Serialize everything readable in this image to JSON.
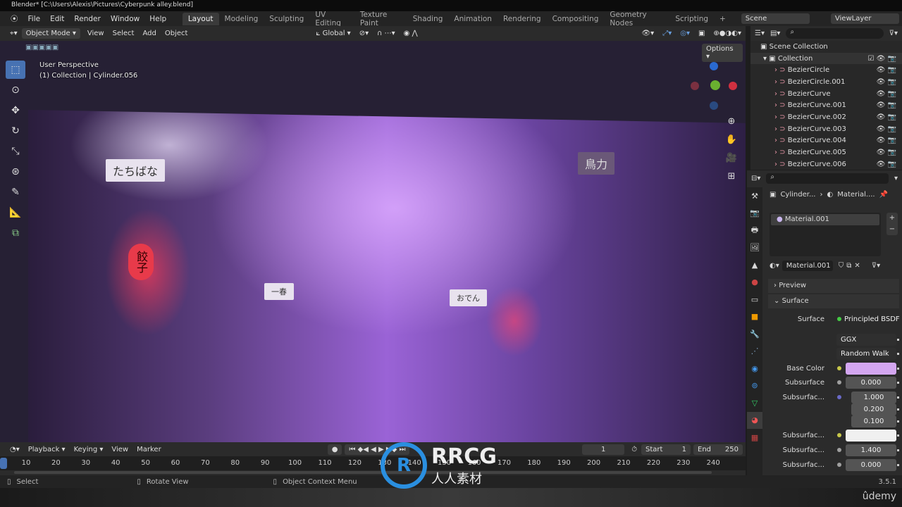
{
  "window_title": "Blender* [C:\\Users\\Alexis\\Pictures\\Cyberpunk alley.blend]",
  "menu": [
    "File",
    "Edit",
    "Render",
    "Window",
    "Help"
  ],
  "workspaces": [
    "Layout",
    "Modeling",
    "Sculpting",
    "UV Editing",
    "Texture Paint",
    "Shading",
    "Animation",
    "Rendering",
    "Compositing",
    "Geometry Nodes",
    "Scripting"
  ],
  "active_workspace": "Layout",
  "scene": "Scene",
  "view_layer": "ViewLayer",
  "viewport_header": {
    "mode": "Object Mode",
    "menus": [
      "View",
      "Select",
      "Add",
      "Object"
    ],
    "transform_orientation": "Global",
    "options": "Options"
  },
  "viewport_overlay": {
    "line1": "User Perspective",
    "line2": "(1) Collection | Cylinder.056"
  },
  "photo_signs": [
    "たちばな",
    "餃子",
    "おでん",
    "鳥力",
    "一春"
  ],
  "outliner": {
    "root": "Scene Collection",
    "collection": "Collection",
    "items": [
      "BezierCircle",
      "BezierCircle.001",
      "BezierCurve",
      "BezierCurve.001",
      "BezierCurve.002",
      "BezierCurve.003",
      "BezierCurve.004",
      "BezierCurve.005",
      "BezierCurve.006"
    ]
  },
  "properties": {
    "breadcrumb_object": "Cylinder...",
    "breadcrumb_material": "Material....",
    "slot": "Material.001",
    "material_name": "Material.001",
    "panels": {
      "preview": "Preview",
      "surface": "Surface"
    },
    "surface_label": "Surface",
    "surface_value": "Principled BSDF",
    "distribution": "GGX",
    "subsurface_method": "Random Walk",
    "rows": [
      {
        "label": "Base Color",
        "value": "",
        "color": "#d3a6f0",
        "dot": "#c8c84a"
      },
      {
        "label": "Subsurface",
        "value": "0.000",
        "dot": "#a0a0a0"
      },
      {
        "label": "Subsurfac...",
        "value": "1.000",
        "dot": "#6a6ac8"
      },
      {
        "label": "",
        "value": "0.200"
      },
      {
        "label": "",
        "value": "0.100"
      },
      {
        "label": "Subsurfac...",
        "value": "",
        "color": "#f0f0f0",
        "dot": "#c8c84a"
      },
      {
        "label": "Subsurfac...",
        "value": "1.400",
        "dot": "#a0a0a0"
      },
      {
        "label": "Subsurfac...",
        "value": "0.000",
        "dot": "#a0a0a0"
      }
    ]
  },
  "timeline": {
    "menus": [
      "Playback",
      "Keying",
      "View",
      "Marker"
    ],
    "current_frame": "1",
    "start_label": "Start",
    "start": "1",
    "end_label": "End",
    "end": "250",
    "ticks": [
      "10",
      "20",
      "30",
      "40",
      "50",
      "60",
      "70",
      "80",
      "90",
      "100",
      "110",
      "120",
      "130",
      "140",
      "150",
      "160",
      "170",
      "180",
      "190",
      "200",
      "210",
      "220",
      "230",
      "240"
    ]
  },
  "statusbar": {
    "select": "Select",
    "rotate": "Rotate View",
    "context": "Object Context Menu",
    "version": "3.5.1"
  },
  "watermark": {
    "brand": "RRCG",
    "sub": "人人素材"
  },
  "udemy": "ûdemy",
  "accent": "#4772b3"
}
